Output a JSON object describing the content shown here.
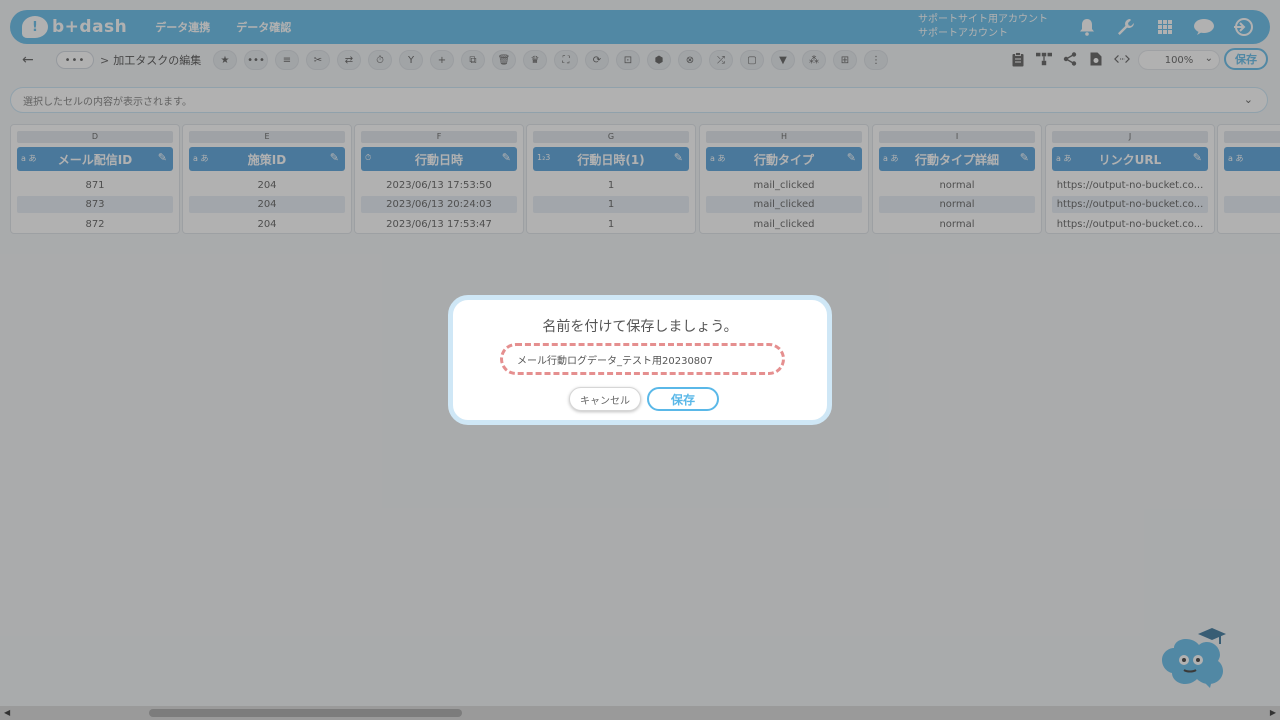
{
  "app": {
    "logo_text": "b+dash",
    "nav": [
      "データ連携",
      "データ確認"
    ],
    "account_line1": "サポートサイト用アカウント",
    "account_line2": "サポートアカウント",
    "top_icons": [
      "bell-icon",
      "wrench-icon",
      "grid-icon",
      "chat-icon",
      "logout-icon"
    ]
  },
  "toolbar": {
    "back_label": "←",
    "crumb_dots": "•••",
    "crumb_separator": ">",
    "crumb_title": "加工タスクの編集",
    "tool_icons": [
      "★",
      "•••",
      "≡",
      "✂",
      "⇄",
      "⏱",
      "Y",
      "+",
      "⧉",
      "🗑",
      "♛",
      "⛶",
      "⟳",
      "⊡",
      "⬢",
      "⊗",
      "⤮",
      "▢",
      "▼",
      "⁂",
      "⊞",
      "⋮"
    ],
    "right_icons": [
      "clipboard-icon",
      "hierarchy-icon",
      "share-icon",
      "download-icon",
      "code-icon"
    ],
    "zoom_value": "100%",
    "save_label": "保存"
  },
  "cellbar": {
    "placeholder": "選択したセルの内容が表示されます。"
  },
  "columns": [
    {
      "letter": "D",
      "name": "メール配信ID",
      "type": "a あ",
      "cells": [
        "871",
        "873",
        "872"
      ]
    },
    {
      "letter": "E",
      "name": "施策ID",
      "type": "a あ",
      "cells": [
        "204",
        "204",
        "204"
      ]
    },
    {
      "letter": "F",
      "name": "行動日時",
      "type": "⏱",
      "cells": [
        "2023/06/13 17:53:50",
        "2023/06/13 20:24:03",
        "2023/06/13 17:53:47"
      ]
    },
    {
      "letter": "G",
      "name": "行動日時(1)",
      "type": "1₂3",
      "cells": [
        "1",
        "1",
        "1"
      ]
    },
    {
      "letter": "H",
      "name": "行動タイプ",
      "type": "a あ",
      "cells": [
        "mail_clicked",
        "mail_clicked",
        "mail_clicked"
      ]
    },
    {
      "letter": "I",
      "name": "行動タイプ詳細",
      "type": "a あ",
      "cells": [
        "normal",
        "normal",
        "normal"
      ]
    },
    {
      "letter": "J",
      "name": "リンクURL",
      "type": "a あ",
      "cells": [
        "https://output-no-bucket.co...",
        "https://output-no-bucket.co...",
        "https://output-no-bucket.co..."
      ]
    },
    {
      "letter": "",
      "name": "",
      "type": "a あ",
      "cells": [
        "",
        "",
        ""
      ]
    }
  ],
  "dialog": {
    "title": "名前を付けて保存しましょう。",
    "input_value": "メール行動ログデータ_テスト用20230807",
    "cancel_label": "キャンセル",
    "save_label": "保存"
  },
  "colors": {
    "accent": "#5ab8e8",
    "header_blue": "#4f9ed9",
    "highlight_dash": "#e58f8f"
  }
}
